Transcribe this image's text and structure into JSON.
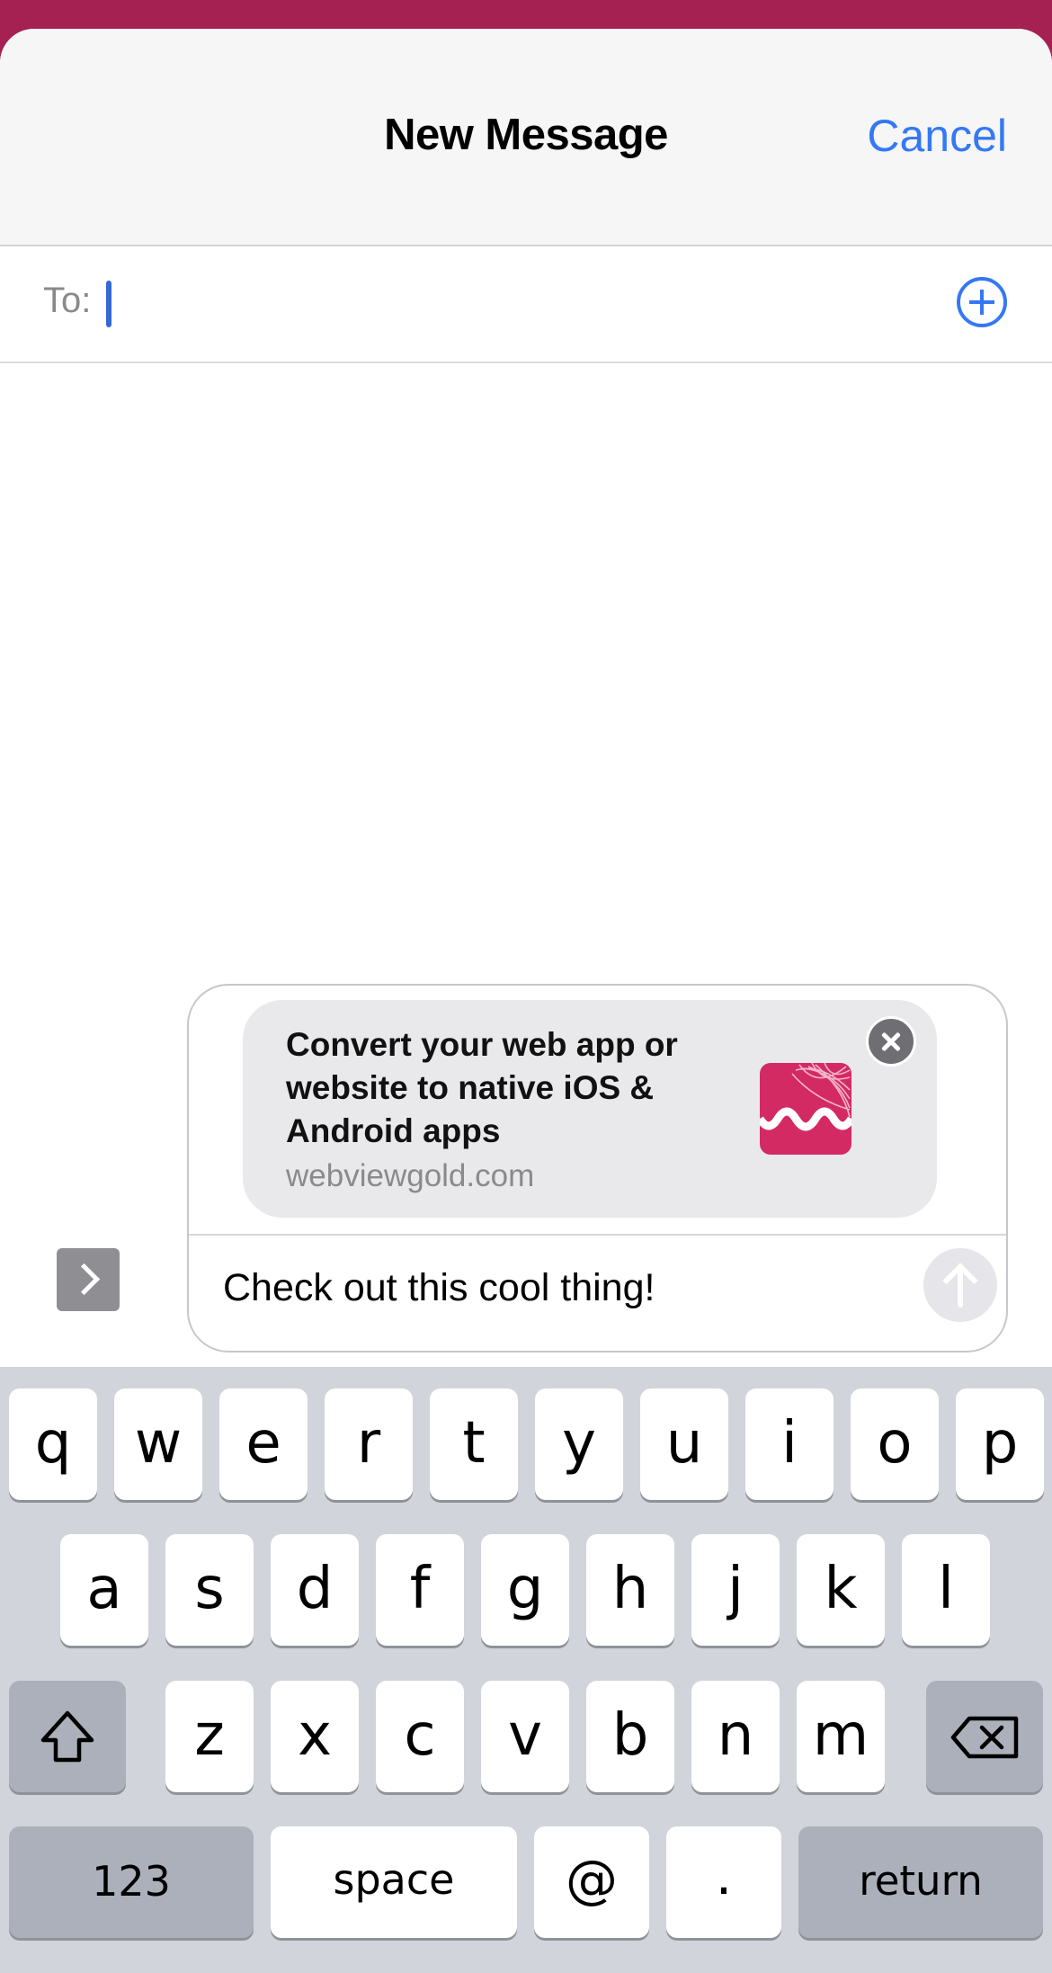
{
  "nav": {
    "title": "New Message",
    "cancel_label": "Cancel"
  },
  "recipient": {
    "label": "To:",
    "value": ""
  },
  "link_preview": {
    "title": "Convert your web app or website to native iOS & Android apps",
    "domain": "webviewgold.com",
    "logo_color": "#d42a64"
  },
  "compose": {
    "message": "Check out this cool thing!"
  },
  "keyboard": {
    "row1": [
      "q",
      "w",
      "e",
      "r",
      "t",
      "y",
      "u",
      "i",
      "o",
      "p"
    ],
    "row2": [
      "a",
      "s",
      "d",
      "f",
      "g",
      "h",
      "j",
      "k",
      "l"
    ],
    "row3": [
      "z",
      "x",
      "c",
      "v",
      "b",
      "n",
      "m"
    ],
    "numbers_label": "123",
    "space_label": "space",
    "at_label": "@",
    "period_label": ".",
    "return_label": "return"
  },
  "colors": {
    "accent": "#3478f6",
    "header_band": "#a42152",
    "keyboard_bg": "#d1d4db"
  }
}
